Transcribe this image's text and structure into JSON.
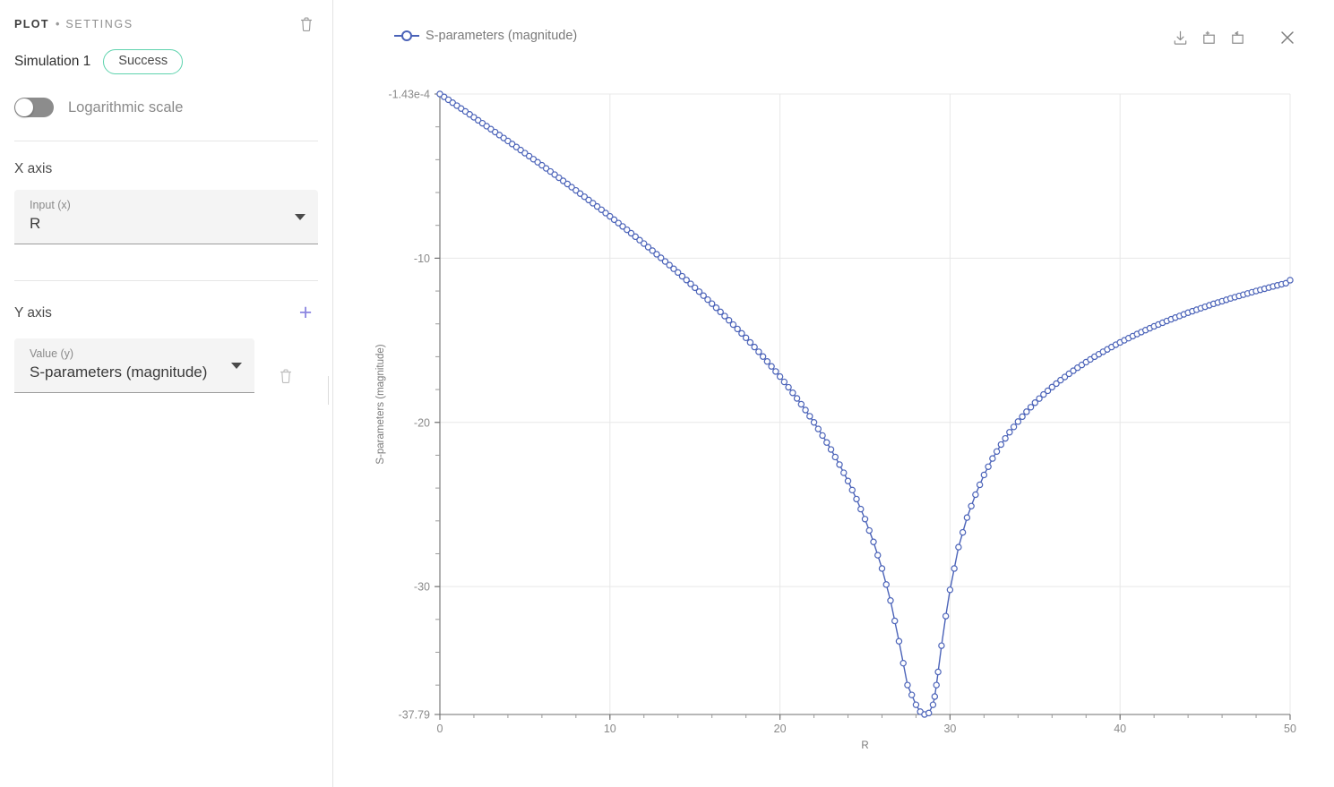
{
  "sidebar": {
    "header": {
      "title": "PLOT",
      "separator": "•",
      "subtitle": "SETTINGS",
      "delete_icon": "trash-icon"
    },
    "simulation": {
      "name": "Simulation 1",
      "status": "Success",
      "status_color": "#5fd3ae"
    },
    "log_toggle": {
      "label": "Logarithmic scale",
      "value": "off"
    },
    "x_axis": {
      "section_title": "X axis",
      "field_label": "Input (x)",
      "field_value": "R"
    },
    "y_axis": {
      "section_title": "Y axis",
      "add_label": "+",
      "add_color": "#8b85e0",
      "field_label": "Value (y)",
      "field_value": "S-parameters (magnitude)",
      "delete_icon": "trash-icon"
    }
  },
  "plot": {
    "legend_label": "S-parameters (magnitude)",
    "tools": [
      {
        "name": "download-icon",
        "label": "Download"
      },
      {
        "name": "add-to-plot-icon",
        "label": "Add plot"
      },
      {
        "name": "reset-plot-icon",
        "label": "Reset plot"
      }
    ],
    "close_label": "Close",
    "line_color": "#4a62b8",
    "grid_color": "#e8e8e8",
    "axis_color": "#6f6f6f"
  },
  "chart_data": {
    "type": "line",
    "title": "",
    "xlabel": "R",
    "ylabel": "S-parameters (magnitude)",
    "legend": [
      "S-parameters (magnitude)"
    ],
    "legend_position": "top-left",
    "grid": true,
    "xlim": [
      0,
      50
    ],
    "ylim": [
      -37.79,
      -0.000143
    ],
    "xticks": [
      0,
      10,
      20,
      30,
      40,
      50
    ],
    "xtick_labels": [
      "0",
      "10",
      "20",
      "30",
      "40",
      "50"
    ],
    "yticks": [
      -0.000143,
      -10,
      -20,
      -30,
      -37.79
    ],
    "ytick_labels": [
      "-1.43e-4",
      "-10",
      "-20",
      "-30",
      "-37.79"
    ],
    "marker": "circle-open",
    "x": [
      0,
      0.5,
      1,
      1.5,
      2,
      2.5,
      3,
      3.5,
      4,
      4.5,
      5,
      5.5,
      6,
      6.5,
      7,
      7.5,
      8,
      8.5,
      9,
      9.5,
      10,
      10.5,
      11,
      11.5,
      12,
      12.5,
      13,
      13.5,
      14,
      14.5,
      15,
      15.5,
      16,
      16.5,
      17,
      17.5,
      18,
      18.5,
      19,
      19.5,
      20,
      20.5,
      21,
      21.5,
      22,
      22.5,
      23,
      23.5,
      24,
      24.5,
      25,
      25.5,
      26,
      26.5,
      27,
      27.5,
      28,
      28.25,
      28.5,
      28.75,
      29,
      29.1,
      29.2,
      29.3,
      29.5,
      29.75,
      30,
      30.5,
      31,
      31.5,
      32,
      32.5,
      33,
      33.5,
      34,
      34.5,
      35,
      35.5,
      36,
      36.5,
      37,
      37.5,
      38,
      38.5,
      39,
      39.5,
      40,
      40.5,
      41,
      41.5,
      42,
      42.5,
      43,
      43.5,
      44,
      44.5,
      45,
      45.5,
      46,
      46.5,
      47,
      47.5,
      48,
      48.5,
      49,
      49.5,
      50
    ],
    "y": [
      -0.000143,
      -0.35,
      -0.71,
      -1.06,
      -1.42,
      -1.78,
      -2.14,
      -2.5,
      -2.86,
      -3.23,
      -3.6,
      -3.97,
      -4.34,
      -4.72,
      -5.1,
      -5.48,
      -5.87,
      -6.26,
      -6.65,
      -7.05,
      -7.45,
      -7.86,
      -8.27,
      -8.69,
      -9.11,
      -9.54,
      -9.98,
      -10.42,
      -10.87,
      -11.33,
      -11.8,
      -12.28,
      -12.77,
      -13.27,
      -13.78,
      -14.31,
      -14.85,
      -15.41,
      -15.99,
      -16.59,
      -17.21,
      -17.86,
      -18.54,
      -19.25,
      -20.0,
      -20.8,
      -21.65,
      -22.57,
      -23.57,
      -24.67,
      -25.89,
      -27.28,
      -28.9,
      -30.85,
      -33.33,
      -36.0,
      -37.2,
      -37.62,
      -37.79,
      -37.7,
      -37.2,
      -36.7,
      -36.0,
      -35.2,
      -33.6,
      -31.8,
      -30.2,
      -27.6,
      -25.8,
      -24.4,
      -23.2,
      -22.2,
      -21.35,
      -20.6,
      -19.95,
      -19.35,
      -18.8,
      -18.3,
      -17.85,
      -17.43,
      -17.04,
      -16.67,
      -16.33,
      -16.0,
      -15.7,
      -15.41,
      -15.13,
      -14.87,
      -14.62,
      -14.38,
      -14.15,
      -13.93,
      -13.72,
      -13.52,
      -13.32,
      -13.14,
      -12.96,
      -12.78,
      -12.62,
      -12.45,
      -12.3,
      -12.15,
      -12.0,
      -11.86,
      -11.72,
      -11.59,
      -11.46,
      -11.34
    ]
  }
}
